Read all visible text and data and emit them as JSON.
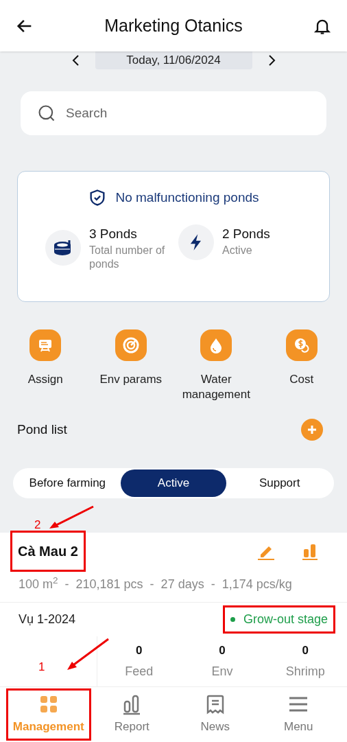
{
  "header": {
    "title": "Marketing Otanics"
  },
  "date": {
    "label": "Today, 11/06/2024"
  },
  "search": {
    "placeholder": "Search"
  },
  "status": {
    "message": "No malfunctioning ponds",
    "stats": [
      {
        "kind": "total",
        "value": "3 Ponds",
        "caption": "Total number of ponds"
      },
      {
        "kind": "active",
        "value": "2 Ponds",
        "caption": "Active"
      }
    ]
  },
  "actions": [
    {
      "kind": "assign",
      "label": "Assign"
    },
    {
      "kind": "gauge",
      "label": "Env params"
    },
    {
      "kind": "water",
      "label": "Water management"
    },
    {
      "kind": "cost",
      "label": "Cost"
    }
  ],
  "pond_list": {
    "title": "Pond list",
    "tabs": [
      {
        "label": "Before farming",
        "selected": false
      },
      {
        "label": "Active",
        "selected": true
      },
      {
        "label": "Support",
        "selected": false
      }
    ]
  },
  "pond": {
    "name": "Cà Mau 2",
    "name_highlighted": true,
    "marker": "2",
    "details": "100 m$^{2}$  -  210,181 pcs  -  27 days  -  1,174 pcs/kg",
    "season": "Vụ 1-2024",
    "stage": {
      "label": "Grow-out stage",
      "color": "#1e9e4a",
      "highlighted": true
    },
    "metrics": [
      {
        "value": "0",
        "label": "Feed"
      },
      {
        "value": "0",
        "label": "Env"
      },
      {
        "value": "0",
        "label": "Shrimp"
      }
    ]
  },
  "nav": [
    {
      "kind": "management",
      "label": "Management",
      "selected": true,
      "highlighted": true,
      "marker": "1"
    },
    {
      "kind": "report",
      "label": "Report",
      "selected": false,
      "highlighted": false
    },
    {
      "kind": "news",
      "label": "News",
      "selected": false,
      "highlighted": false
    },
    {
      "kind": "menu",
      "label": "Menu",
      "selected": false,
      "highlighted": false
    }
  ]
}
